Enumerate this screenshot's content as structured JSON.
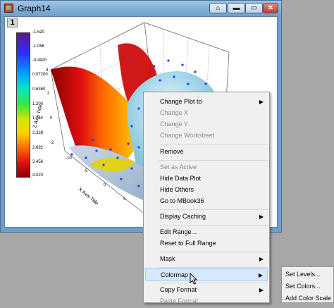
{
  "window": {
    "title": "Graph14",
    "home_btn": "⌂",
    "min_btn": "▬",
    "max_btn": "▭",
    "close_btn": "✕",
    "layer_label": "1"
  },
  "colorbar": {
    "labels": [
      "-1.620",
      "-1.056",
      "-0.4920",
      "0.07200",
      "0.6360",
      "1.200",
      "1.764",
      "2.328",
      "2.892",
      "3.456",
      "4.020"
    ]
  },
  "plot": {
    "x_axis_title": "X Axis Title",
    "z_axis_title": "Z Axis Title",
    "x_ticks": [
      "-10",
      "-5",
      "0",
      "5",
      "10"
    ],
    "z_ticks": [
      "4",
      "2",
      "0",
      "-2"
    ],
    "y_ticks": [
      "-2"
    ]
  },
  "context_menu": {
    "items": [
      {
        "label": "Change Plot to",
        "disabled": false,
        "submenu": true
      },
      {
        "label": "Change X",
        "disabled": true,
        "submenu": false
      },
      {
        "label": "Change Y",
        "disabled": true,
        "submenu": false
      },
      {
        "label": "Change Worksheet",
        "disabled": true,
        "submenu": false
      },
      {
        "label": "Remove",
        "disabled": false,
        "submenu": false
      },
      {
        "label": "Set as Active",
        "disabled": true,
        "submenu": false
      },
      {
        "label": "Hide Data Plot",
        "disabled": false,
        "submenu": false
      },
      {
        "label": "Hide Others",
        "disabled": false,
        "submenu": false
      },
      {
        "label": "Go to MBook36",
        "disabled": false,
        "submenu": false
      },
      {
        "label": "Display Caching",
        "disabled": false,
        "submenu": true
      },
      {
        "label": "Edit Range...",
        "disabled": false,
        "submenu": false
      },
      {
        "label": "Reset to Full Range",
        "disabled": false,
        "submenu": false
      },
      {
        "label": "Mask",
        "disabled": false,
        "submenu": true
      },
      {
        "label": "Colormap",
        "disabled": false,
        "submenu": true,
        "highlighted": true
      },
      {
        "label": "Copy Format",
        "disabled": false,
        "submenu": true
      },
      {
        "label": "Paste Format",
        "disabled": true,
        "submenu": false
      }
    ],
    "arrow_glyph": "▶"
  },
  "colormap_submenu": {
    "items": [
      "Set Levels...",
      "Set Colors...",
      "Add Color Scale"
    ]
  }
}
